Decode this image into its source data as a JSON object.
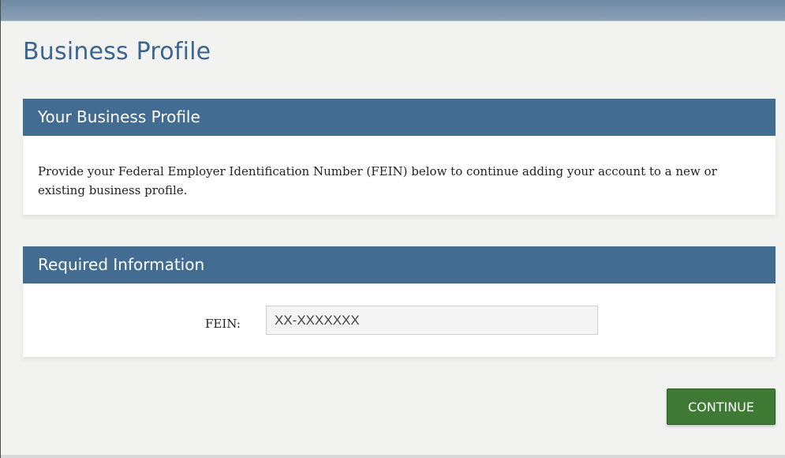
{
  "page": {
    "title": "Business Profile"
  },
  "profile_section": {
    "header": "Your Business Profile",
    "description": "Provide your Federal Employer Identification Number (FEIN) below to continue adding your account to a new or existing business profile."
  },
  "required_section": {
    "header": "Required Information",
    "fein_label": "FEIN:",
    "fein_placeholder": "XX-XXXXXXX",
    "fein_value": ""
  },
  "actions": {
    "continue_label": "CONTINUE"
  },
  "colors": {
    "title": "#3c6690",
    "section_header_bg": "#436c93",
    "button_bg": "#3e7a33",
    "page_bg": "#f2f2f1"
  }
}
